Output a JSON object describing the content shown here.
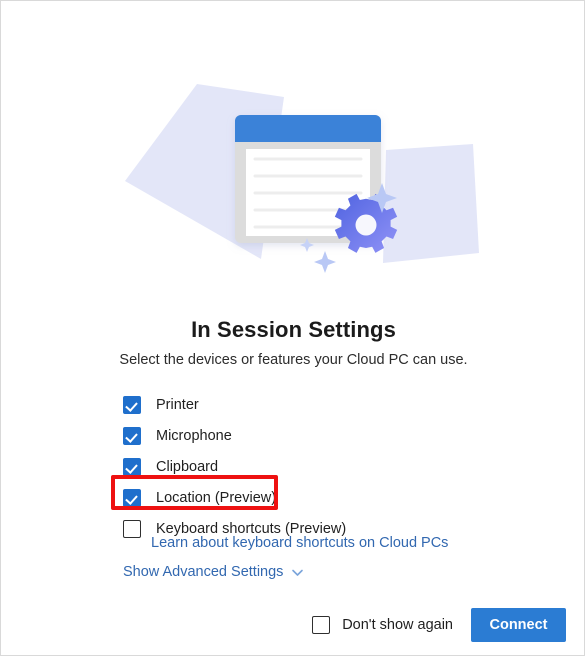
{
  "window": {
    "border_color": "#d9d9d9",
    "background": "#ffffff"
  },
  "illustration": {
    "name": "in-session-settings-illustration",
    "description": "Document window with blue title bar, gear and sparkles over lavender paper shapes",
    "colors": {
      "paper_shape": "#e3e6f8",
      "window_frame": "#dcdcdc",
      "window_titlebar": "#3b82d8",
      "window_page": "#ffffff",
      "text_line": "#ededed",
      "gear_start": "#4f63e0",
      "gear_end": "#8f90f5",
      "sparkle": "#b9c8f5"
    },
    "document_line_count": 5
  },
  "header": {
    "title": "In Session Settings",
    "subtitle": "Select the devices or features your Cloud PC can use."
  },
  "options": [
    {
      "label": "Printer",
      "checked": true,
      "highlighted": false
    },
    {
      "label": "Microphone",
      "checked": true,
      "highlighted": false
    },
    {
      "label": "Clipboard",
      "checked": true,
      "highlighted": false
    },
    {
      "label": "Location (Preview)",
      "checked": true,
      "highlighted": true
    },
    {
      "label": "Keyboard shortcuts (Preview)",
      "checked": false,
      "highlighted": false
    }
  ],
  "links": {
    "learn_keyboard_shortcuts": "Learn about keyboard shortcuts on Cloud PCs",
    "show_advanced_settings": "Show Advanced Settings",
    "link_color": "#3268b0"
  },
  "footer": {
    "dont_show_again_label": "Don't show again",
    "dont_show_again_checked": false,
    "connect_label": "Connect",
    "connect_color": "#2b7cd3"
  },
  "annotation": {
    "target": "Location (Preview)",
    "color": "#ee1111"
  }
}
